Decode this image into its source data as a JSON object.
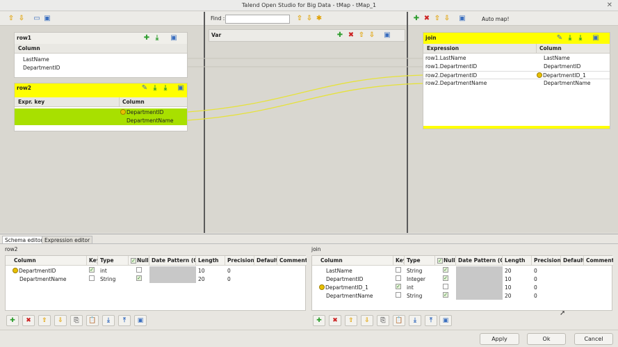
{
  "window": {
    "title": "Talend Open Studio for Big Data - tMap - tMap_1",
    "close_glyph": "✕"
  },
  "find": {
    "label": "Find :",
    "value": ""
  },
  "automap": {
    "label": "Auto map!"
  },
  "inputs": {
    "row1": {
      "title": "row1",
      "column_header": "Column",
      "rows": [
        "LastName",
        "DepartmentID"
      ]
    },
    "row2": {
      "title": "row2",
      "expr_header": "Expr. key",
      "column_header": "Column",
      "rows": [
        "DepartmentID",
        "DepartmentName"
      ]
    }
  },
  "var": {
    "title": "Var"
  },
  "output": {
    "title": "join",
    "expr_header": "Expression",
    "column_header": "Column",
    "rows": [
      {
        "expr": "row1.LastName",
        "col": "LastName"
      },
      {
        "expr": "row1.DepartmentID",
        "col": "DepartmentID"
      },
      {
        "expr": "row2.DepartmentID",
        "col": "DepartmentID_1"
      },
      {
        "expr": "row2.DepartmentName",
        "col": "DepartmentName"
      }
    ]
  },
  "tabs": [
    "Schema editor",
    "Expression editor"
  ],
  "schema_headers": [
    "Column",
    "Key",
    "Type",
    "Nullable",
    "Date Pattern (Ctr",
    "Length",
    "Precision",
    "Default",
    "Comment"
  ],
  "schema_left": {
    "title": "row2",
    "rows": [
      {
        "col": "DepartmentID",
        "key": true,
        "type": "int",
        "nullable": false,
        "length": "10",
        "precision": "0"
      },
      {
        "col": "DepartmentName",
        "key": false,
        "type": "String",
        "nullable": true,
        "length": "20",
        "precision": "0"
      }
    ]
  },
  "schema_right": {
    "title": "join",
    "rows": [
      {
        "col": "LastName",
        "key": false,
        "type": "String",
        "nullable": true,
        "length": "20",
        "precision": "0"
      },
      {
        "col": "DepartmentID",
        "key": false,
        "type": "Integer",
        "nullable": true,
        "length": "10",
        "precision": "0"
      },
      {
        "col": "DepartmentID_1",
        "key": true,
        "type": "int",
        "nullable": false,
        "length": "10",
        "precision": "0"
      },
      {
        "col": "DepartmentName",
        "key": false,
        "type": "String",
        "nullable": true,
        "length": "20",
        "precision": "0"
      }
    ]
  },
  "buttons": {
    "apply": "Apply",
    "ok": "Ok",
    "cancel": "Cancel"
  },
  "colors": {
    "yellow": "#ffff00",
    "green": "#a8e000",
    "link": "#e6e23a"
  }
}
